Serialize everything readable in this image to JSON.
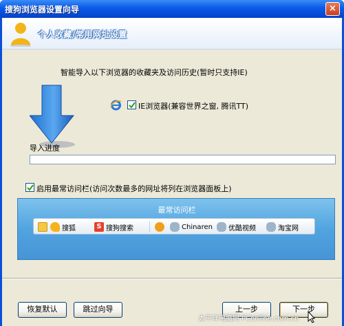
{
  "window": {
    "title": "搜狗浏览器设置向导",
    "close_glyph": "×"
  },
  "header": {
    "title": "个人收藏/常用网址设置"
  },
  "intro": {
    "text": "智能导入以下浏览器的收藏夹及访问历史(暂时只支持IE)"
  },
  "import": {
    "ie_label": "IE浏览器(兼容世界之窗, 腾讯TT)",
    "ie_checked": true
  },
  "progress": {
    "label": "导入进度",
    "value": 0
  },
  "frequent": {
    "label": "启用最常访问栏(访问次数最多的网址将列在浏览器面板上)",
    "checked": true
  },
  "preview": {
    "title": "最常访问栏",
    "items": [
      {
        "label": "搜狐",
        "icon": "sohu-icon"
      },
      {
        "label": "搜狗搜索",
        "icon": "sogou-icon"
      },
      {
        "label": "Chinaren",
        "icon": "chinaren-icon"
      },
      {
        "label": "优酷视频",
        "icon": "youku-icon"
      },
      {
        "label": "淘宝网",
        "icon": "taobao-icon"
      }
    ]
  },
  "buttons": {
    "restore": "恢复默认",
    "skip": "跳过向导",
    "prev": "上一步",
    "next": "下一步"
  },
  "watermark": "太平洋电脑网 PConline.com.cn",
  "colors": {
    "titlebar": "#0a5ae8",
    "face": "#ece9d8",
    "preview": "#52a4e0"
  }
}
